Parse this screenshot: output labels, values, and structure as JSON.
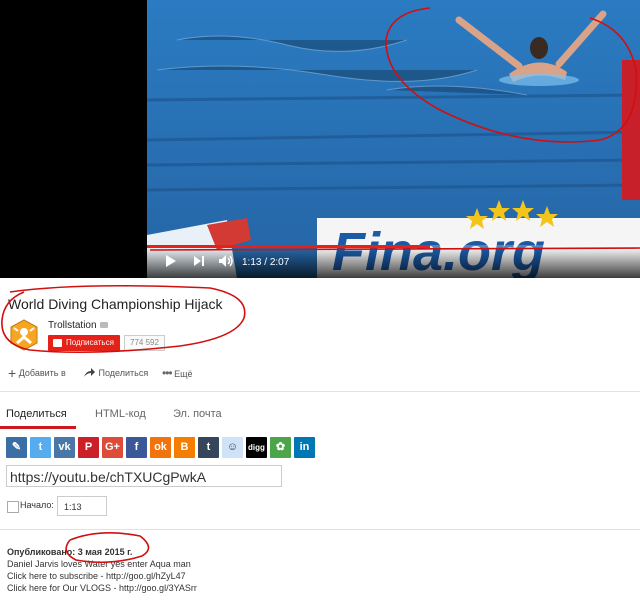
{
  "player": {
    "time_current": "1:13",
    "time_separator": " / ",
    "time_total": "2:07",
    "progress_fraction": 0.575,
    "banner_text": "Fina.org"
  },
  "video": {
    "title": "World Diving Championship Hijack",
    "channel_name": "Trollstation",
    "subscribe_label": "Подписаться",
    "subscriber_count": "774 592"
  },
  "actions": [
    {
      "label": "Добавить в",
      "icon": "plus-icon"
    },
    {
      "label": "Поделиться",
      "icon": "share-arrow-icon"
    },
    {
      "label": "Ещё",
      "icon": "more-dots-icon"
    }
  ],
  "share": {
    "tabs": [
      "Поделиться",
      "HTML-код",
      "Эл. почта"
    ],
    "active_tab": 0,
    "networks": [
      {
        "name": "blogger-post",
        "color": "#3b6ea5",
        "glyph": "✎"
      },
      {
        "name": "twitter",
        "color": "#55acee",
        "glyph": "t"
      },
      {
        "name": "vk",
        "color": "#4a76a8",
        "glyph": "vk"
      },
      {
        "name": "pinterest",
        "color": "#cb2027",
        "glyph": "P"
      },
      {
        "name": "google-plus",
        "color": "#dd4b39",
        "glyph": "G+"
      },
      {
        "name": "facebook",
        "color": "#3b5998",
        "glyph": "f"
      },
      {
        "name": "odnoklassniki",
        "color": "#f2720c",
        "glyph": "ok"
      },
      {
        "name": "blogger",
        "color": "#f57d00",
        "glyph": "B"
      },
      {
        "name": "tumblr",
        "color": "#35465c",
        "glyph": "t"
      },
      {
        "name": "reddit",
        "color": "#cee3f8",
        "glyph": "☺"
      },
      {
        "name": "digg",
        "color": "#000000",
        "glyph": "digg"
      },
      {
        "name": "stumbleupon",
        "color": "#4ca649",
        "glyph": "✿"
      },
      {
        "name": "linkedin",
        "color": "#0077b5",
        "glyph": "in"
      }
    ],
    "url": "https://youtu.be/chTXUCgPwkA",
    "start_label": "Начало:",
    "start_value": "1:13"
  },
  "description": {
    "published": "Опубликовано: 3 мая 2015 г.",
    "lines": [
      "Daniel Jarvis loves Water yes enter Aqua man",
      "Click here to subscribe - http://goo.gl/hZyL47",
      "Click here for Our VLOGS - http://goo.gl/3YASrr"
    ]
  },
  "colors": {
    "youtube_red": "#e62117",
    "annotation_red": "#d10f0f",
    "pool_blue": "#2f7fc4"
  }
}
